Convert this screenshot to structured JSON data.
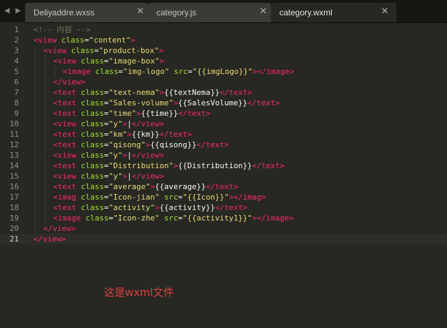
{
  "tabs": [
    {
      "label": "Deliyaddre.wxss",
      "active": false
    },
    {
      "label": "category.js",
      "active": false
    },
    {
      "label": "category.wxml",
      "active": true
    }
  ],
  "nav": {
    "left_icon": "chevron-left-icon",
    "right_icon": "chevron-right-icon"
  },
  "close_icon": "close-icon",
  "editor": {
    "current_line": 21,
    "lines": [
      {
        "n": "1",
        "indent": 0,
        "parts": [
          [
            "com",
            "<!-- 内容 -->"
          ]
        ]
      },
      {
        "n": "2",
        "indent": 0,
        "parts": [
          [
            "tag",
            "<view"
          ],
          [
            "attr",
            " class"
          ],
          [
            "pl",
            "="
          ],
          [
            "str",
            "\"content\""
          ],
          [
            "tag",
            ">"
          ]
        ]
      },
      {
        "n": "3",
        "indent": 1,
        "parts": [
          [
            "tag",
            "<view"
          ],
          [
            "attr",
            " class"
          ],
          [
            "pl",
            "="
          ],
          [
            "str",
            "\"product-box\""
          ],
          [
            "tag",
            ">"
          ]
        ]
      },
      {
        "n": "4",
        "indent": 2,
        "parts": [
          [
            "tag",
            "<view"
          ],
          [
            "attr",
            " class"
          ],
          [
            "pl",
            "="
          ],
          [
            "str",
            "\"image-box\""
          ],
          [
            "tag",
            ">"
          ]
        ]
      },
      {
        "n": "5",
        "indent": 3,
        "parts": [
          [
            "tag",
            "<image"
          ],
          [
            "attr",
            " class"
          ],
          [
            "pl",
            "="
          ],
          [
            "str",
            "\"img-logo\""
          ],
          [
            "attr",
            " src"
          ],
          [
            "pl",
            "="
          ],
          [
            "str",
            "\"{{imgLogo}}\""
          ],
          [
            "tag",
            "></image>"
          ]
        ]
      },
      {
        "n": "6",
        "indent": 2,
        "parts": [
          [
            "tag",
            "</view>"
          ]
        ]
      },
      {
        "n": "7",
        "indent": 2,
        "parts": [
          [
            "tag",
            "<text"
          ],
          [
            "attr",
            " class"
          ],
          [
            "pl",
            "="
          ],
          [
            "str",
            "\"text-nema\""
          ],
          [
            "tag",
            ">"
          ],
          [
            "pl",
            "{{textNema}}"
          ],
          [
            "tag",
            "</text>"
          ]
        ]
      },
      {
        "n": "8",
        "indent": 2,
        "parts": [
          [
            "tag",
            "<text"
          ],
          [
            "attr",
            " class"
          ],
          [
            "pl",
            "="
          ],
          [
            "str",
            "\"Sales-volume\""
          ],
          [
            "tag",
            ">"
          ],
          [
            "pl",
            "{{SalesVolume}}"
          ],
          [
            "tag",
            "</text>"
          ]
        ]
      },
      {
        "n": "9",
        "indent": 2,
        "parts": [
          [
            "tag",
            "<text"
          ],
          [
            "attr",
            " class"
          ],
          [
            "pl",
            "="
          ],
          [
            "str",
            "\"time\""
          ],
          [
            "tag",
            ">"
          ],
          [
            "pl",
            "{{time}}"
          ],
          [
            "tag",
            "</text>"
          ]
        ]
      },
      {
        "n": "10",
        "indent": 2,
        "parts": [
          [
            "tag",
            "<view"
          ],
          [
            "attr",
            " class"
          ],
          [
            "pl",
            "="
          ],
          [
            "str",
            "\"y\""
          ],
          [
            "tag",
            ">"
          ],
          [
            "pl",
            "|"
          ],
          [
            "tag",
            "</view>"
          ]
        ]
      },
      {
        "n": "11",
        "indent": 2,
        "parts": [
          [
            "tag",
            "<text"
          ],
          [
            "attr",
            " class"
          ],
          [
            "pl",
            "="
          ],
          [
            "str",
            "\"km\""
          ],
          [
            "tag",
            ">"
          ],
          [
            "pl",
            "{{km}}"
          ],
          [
            "tag",
            "</text>"
          ]
        ]
      },
      {
        "n": "12",
        "indent": 2,
        "parts": [
          [
            "tag",
            "<text"
          ],
          [
            "attr",
            " class"
          ],
          [
            "pl",
            "="
          ],
          [
            "str",
            "\"qisong\""
          ],
          [
            "tag",
            ">"
          ],
          [
            "pl",
            "{{qisong}}"
          ],
          [
            "tag",
            "</text>"
          ]
        ]
      },
      {
        "n": "13",
        "indent": 2,
        "parts": [
          [
            "tag",
            "<view"
          ],
          [
            "attr",
            " class"
          ],
          [
            "pl",
            "="
          ],
          [
            "str",
            "\"y\""
          ],
          [
            "tag",
            ">"
          ],
          [
            "pl",
            "|"
          ],
          [
            "tag",
            "</view>"
          ]
        ]
      },
      {
        "n": "14",
        "indent": 2,
        "parts": [
          [
            "tag",
            "<text"
          ],
          [
            "attr",
            " class"
          ],
          [
            "pl",
            "="
          ],
          [
            "str",
            "\"Distribution\""
          ],
          [
            "tag",
            ">"
          ],
          [
            "pl",
            "{{Distribution}}"
          ],
          [
            "tag",
            "</text>"
          ]
        ]
      },
      {
        "n": "15",
        "indent": 2,
        "parts": [
          [
            "tag",
            "<view"
          ],
          [
            "attr",
            " class"
          ],
          [
            "pl",
            "="
          ],
          [
            "str",
            "\"y\""
          ],
          [
            "tag",
            ">"
          ],
          [
            "pl",
            "|"
          ],
          [
            "tag",
            "</view>"
          ]
        ]
      },
      {
        "n": "16",
        "indent": 2,
        "parts": [
          [
            "tag",
            "<text"
          ],
          [
            "attr",
            " class"
          ],
          [
            "pl",
            "="
          ],
          [
            "str",
            "\"average\""
          ],
          [
            "tag",
            ">"
          ],
          [
            "pl",
            "{{average}}"
          ],
          [
            "tag",
            "</text>"
          ]
        ]
      },
      {
        "n": "17",
        "indent": 2,
        "parts": [
          [
            "tag",
            "<imag"
          ],
          [
            "attr",
            " class"
          ],
          [
            "pl",
            "="
          ],
          [
            "str",
            "\"Icon-jian\""
          ],
          [
            "attr",
            " src"
          ],
          [
            "pl",
            "="
          ],
          [
            "str",
            "\"{{Icon}}\""
          ],
          [
            "tag",
            "></imag>"
          ]
        ]
      },
      {
        "n": "18",
        "indent": 2,
        "parts": [
          [
            "tag",
            "<text"
          ],
          [
            "attr",
            " class"
          ],
          [
            "pl",
            "="
          ],
          [
            "str",
            "\"activity\""
          ],
          [
            "tag",
            ">"
          ],
          [
            "pl",
            "{{activity}}"
          ],
          [
            "tag",
            "</text>"
          ]
        ]
      },
      {
        "n": "19",
        "indent": 2,
        "parts": [
          [
            "tag",
            "<image"
          ],
          [
            "attr",
            " class"
          ],
          [
            "pl",
            "="
          ],
          [
            "str",
            "\"Icon-zhe\""
          ],
          [
            "attr",
            " src"
          ],
          [
            "pl",
            "="
          ],
          [
            "str",
            "\"{{activity1}}\""
          ],
          [
            "tag",
            "></image>"
          ]
        ]
      },
      {
        "n": "20",
        "indent": 1,
        "parts": [
          [
            "tag",
            "</view>"
          ]
        ]
      },
      {
        "n": "21",
        "indent": 0,
        "parts": [
          [
            "tag",
            "</view>"
          ]
        ]
      }
    ]
  },
  "caption": "这是wxml文件"
}
